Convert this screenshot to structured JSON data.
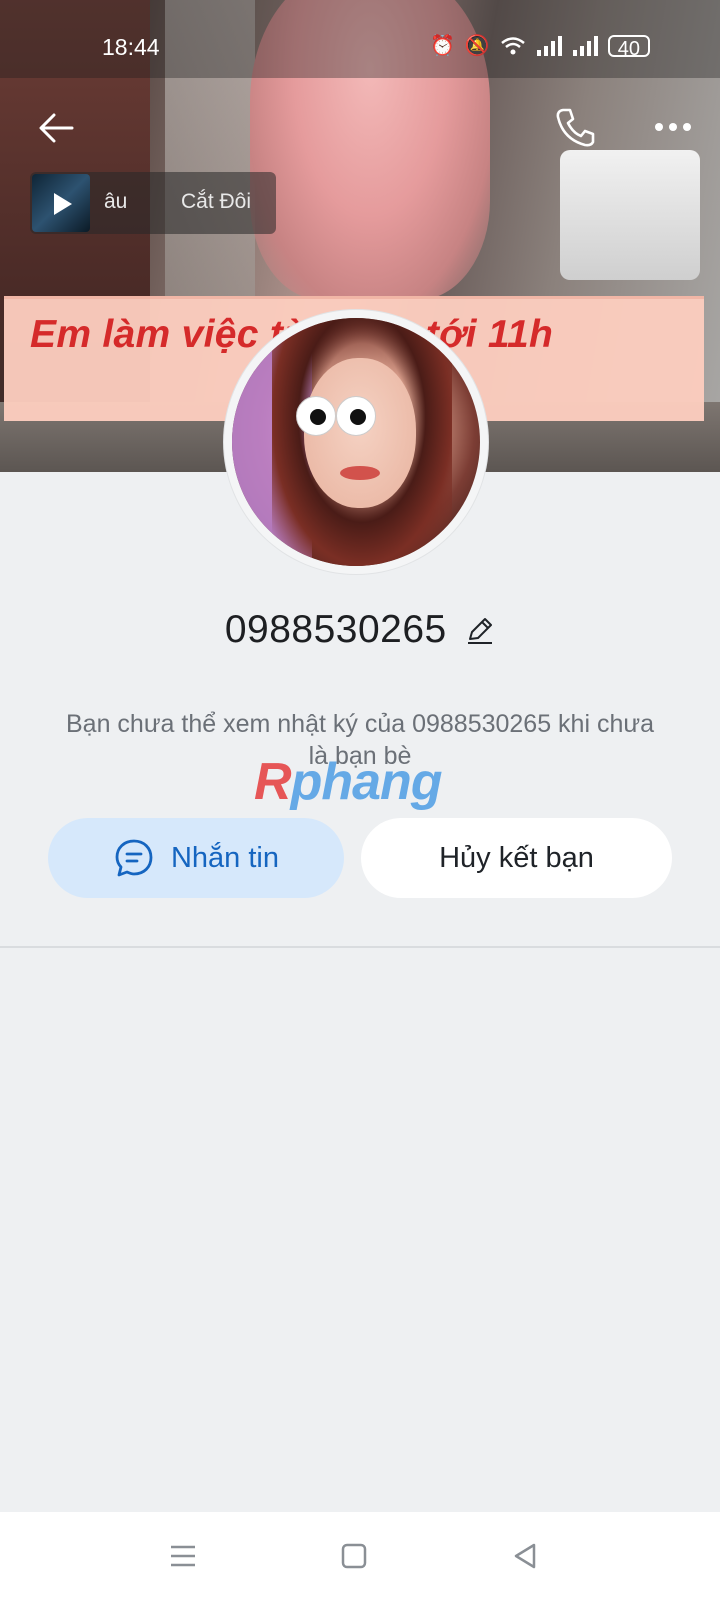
{
  "status_bar": {
    "time": "18:44",
    "battery": "40",
    "icons": [
      "alarm-icon",
      "mute-icon",
      "wifi-icon",
      "signal-icon",
      "signal-icon"
    ]
  },
  "header": {
    "back_icon": "arrow-left-icon",
    "call_icon": "phone-icon",
    "more_icon": "more-horizontal-icon"
  },
  "music": {
    "artist": "âu",
    "title": "Cắt Đôi"
  },
  "cover_banner": {
    "text": "Em làm việc từ sáng tới 11h"
  },
  "profile": {
    "name": "0988530265",
    "edit_icon": "pencil-icon",
    "note": "Bạn chưa thể xem nhật ký của 0988530265 khi chưa là bạn bè"
  },
  "watermark": {
    "r": "R",
    "text": "phang"
  },
  "actions": {
    "message_label": "Nhắn tin",
    "unfriend_label": "Hủy kết bạn"
  },
  "nav": {
    "items": [
      "menu-icon",
      "home-icon",
      "back-icon"
    ]
  },
  "colors": {
    "background": "#eef0f2",
    "accent_blue": "#1565c0",
    "message_button_bg": "#d6e8fb",
    "banner_bg": "#fccdbe",
    "banner_text": "#d52a2a"
  }
}
